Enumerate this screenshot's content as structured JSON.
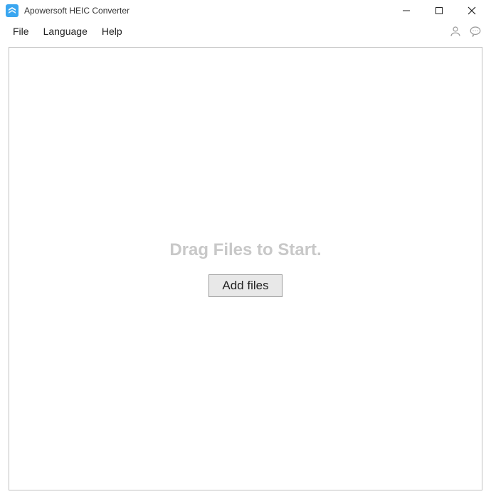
{
  "titlebar": {
    "app_title": "Apowersoft HEIC Converter"
  },
  "menubar": {
    "file_label": "File",
    "language_label": "Language",
    "help_label": "Help"
  },
  "main": {
    "drag_prompt": "Drag Files to Start.",
    "add_files_label": "Add files"
  }
}
